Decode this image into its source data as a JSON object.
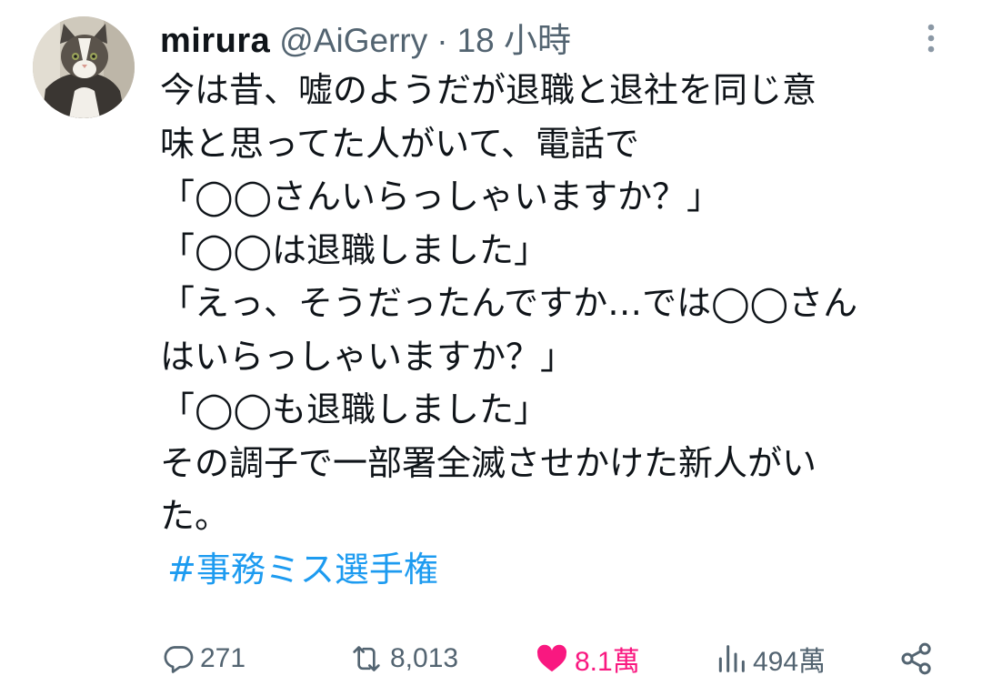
{
  "tweet": {
    "display_name": "mirura",
    "handle": "@AiGerry",
    "separator": "·",
    "timestamp": "18 小時",
    "lines": [
      "今は昔、嘘のようだが退職と退社を同じ意",
      "味と思ってた人がいて、電話で",
      "「◯◯さんいらっしゃいますか？」",
      "「◯◯は退職しました」",
      "「えっ、そうだったんですか…では◯◯さん",
      "はいらっしゃいますか？」",
      "「◯◯も退職しました」",
      "その調子で一部署全滅させかけた新人がい",
      "た。"
    ],
    "hashtag": "#事務ミス選手権"
  },
  "actions": {
    "replies": "271",
    "retweets": "8,013",
    "likes": "8.1萬",
    "views": "494萬"
  },
  "icons": {
    "more": "more-vertical-icon",
    "reply": "reply-icon",
    "retweet": "retweet-icon",
    "like": "heart-filled-icon",
    "views": "views-chart-icon",
    "share": "share-icon"
  },
  "colors": {
    "text": "#0f1419",
    "secondary": "#536471",
    "link": "#1d9bf0",
    "like": "#f91880"
  }
}
